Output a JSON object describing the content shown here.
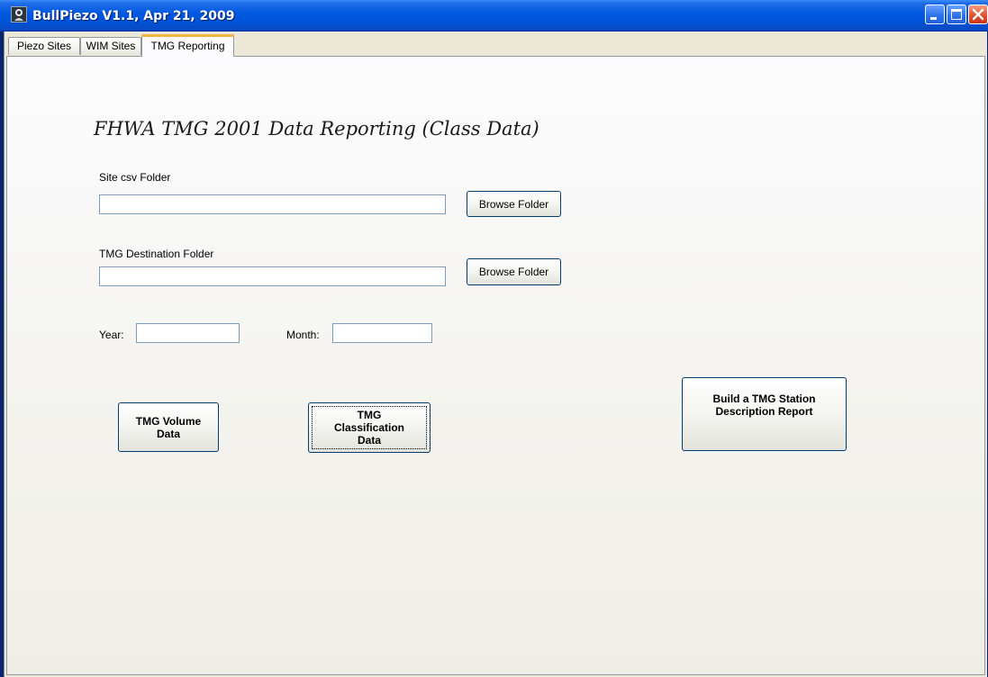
{
  "window": {
    "title": "BullPiezo V1.1, Apr 21, 2009"
  },
  "tabs": [
    {
      "label": "Piezo Sites"
    },
    {
      "label": "WIM Sites"
    },
    {
      "label": "TMG Reporting",
      "selected": true
    }
  ],
  "main": {
    "heading": "FHWA TMG 2001 Data Reporting (Class Data)",
    "site_csv_label": "Site csv Folder",
    "site_csv_value": "",
    "browse_label": "Browse Folder",
    "dest_label": "TMG Destination Folder",
    "dest_value": "",
    "year_label": "Year:",
    "year_value": "",
    "month_label": "Month:",
    "month_value": "",
    "volume_button": {
      "line1": "TMG Volume",
      "line2": "Data"
    },
    "class_button": {
      "line1": "TMG",
      "line2": "Classification",
      "line3": "Data"
    },
    "station_button": {
      "line1": "Build a TMG Station",
      "line2": "Description Report"
    }
  },
  "colors": {
    "titlebar": "#0058e0",
    "window_bg": "#ece9d8",
    "close_button": "#e3502a",
    "active_tab_accent": "#f5b440"
  },
  "icons": {
    "app": "app-icon",
    "minimize": "minimize-icon",
    "maximize": "maximize-icon",
    "close": "close-icon"
  }
}
